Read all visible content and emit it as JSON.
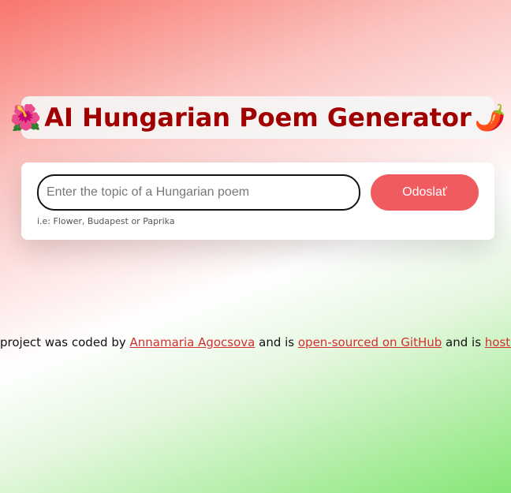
{
  "header": {
    "emoji_left": "🌺",
    "title": "AI Hungarian Poem Generator",
    "emoji_right": "🌶️"
  },
  "form": {
    "input_placeholder": "Enter the topic of a Hungarian poem",
    "input_value": "",
    "submit_label": "Odoslať",
    "hint": "i.e: Flower, Budapest or Paprika"
  },
  "footer": {
    "text_1": "project was coded by ",
    "author_link": "Annamaria Agocsova",
    "text_2": " and is ",
    "github_link": "open-sourced on GitHub",
    "text_3": " and is ",
    "hosted_link": "hosted on"
  },
  "colors": {
    "title": "#a00000",
    "button": "#ef5b5f",
    "link": "#d32f2f"
  }
}
